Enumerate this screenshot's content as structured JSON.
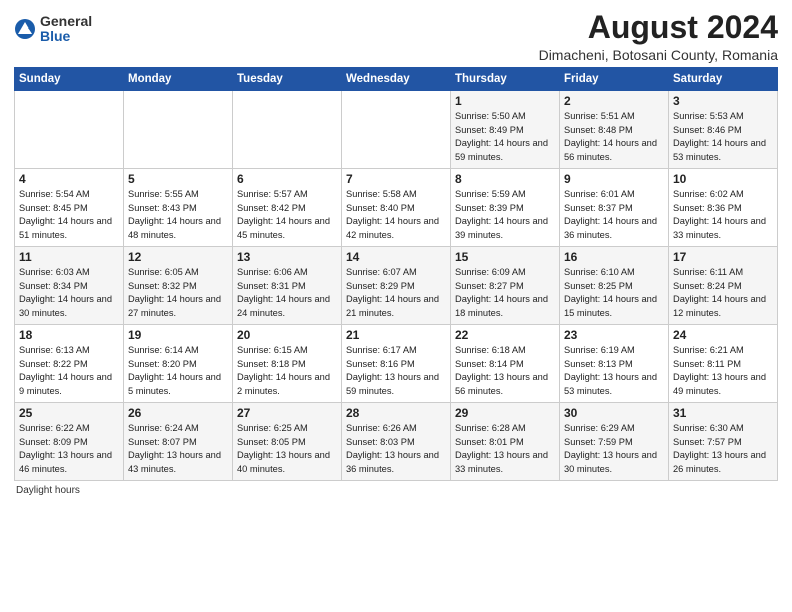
{
  "logo": {
    "general": "General",
    "blue": "Blue"
  },
  "title": "August 2024",
  "subtitle": "Dimacheni, Botosani County, Romania",
  "weekdays": [
    "Sunday",
    "Monday",
    "Tuesday",
    "Wednesday",
    "Thursday",
    "Friday",
    "Saturday"
  ],
  "weeks": [
    [
      {
        "day": "",
        "info": ""
      },
      {
        "day": "",
        "info": ""
      },
      {
        "day": "",
        "info": ""
      },
      {
        "day": "",
        "info": ""
      },
      {
        "day": "1",
        "info": "Sunrise: 5:50 AM\nSunset: 8:49 PM\nDaylight: 14 hours and 59 minutes."
      },
      {
        "day": "2",
        "info": "Sunrise: 5:51 AM\nSunset: 8:48 PM\nDaylight: 14 hours and 56 minutes."
      },
      {
        "day": "3",
        "info": "Sunrise: 5:53 AM\nSunset: 8:46 PM\nDaylight: 14 hours and 53 minutes."
      }
    ],
    [
      {
        "day": "4",
        "info": "Sunrise: 5:54 AM\nSunset: 8:45 PM\nDaylight: 14 hours and 51 minutes."
      },
      {
        "day": "5",
        "info": "Sunrise: 5:55 AM\nSunset: 8:43 PM\nDaylight: 14 hours and 48 minutes."
      },
      {
        "day": "6",
        "info": "Sunrise: 5:57 AM\nSunset: 8:42 PM\nDaylight: 14 hours and 45 minutes."
      },
      {
        "day": "7",
        "info": "Sunrise: 5:58 AM\nSunset: 8:40 PM\nDaylight: 14 hours and 42 minutes."
      },
      {
        "day": "8",
        "info": "Sunrise: 5:59 AM\nSunset: 8:39 PM\nDaylight: 14 hours and 39 minutes."
      },
      {
        "day": "9",
        "info": "Sunrise: 6:01 AM\nSunset: 8:37 PM\nDaylight: 14 hours and 36 minutes."
      },
      {
        "day": "10",
        "info": "Sunrise: 6:02 AM\nSunset: 8:36 PM\nDaylight: 14 hours and 33 minutes."
      }
    ],
    [
      {
        "day": "11",
        "info": "Sunrise: 6:03 AM\nSunset: 8:34 PM\nDaylight: 14 hours and 30 minutes."
      },
      {
        "day": "12",
        "info": "Sunrise: 6:05 AM\nSunset: 8:32 PM\nDaylight: 14 hours and 27 minutes."
      },
      {
        "day": "13",
        "info": "Sunrise: 6:06 AM\nSunset: 8:31 PM\nDaylight: 14 hours and 24 minutes."
      },
      {
        "day": "14",
        "info": "Sunrise: 6:07 AM\nSunset: 8:29 PM\nDaylight: 14 hours and 21 minutes."
      },
      {
        "day": "15",
        "info": "Sunrise: 6:09 AM\nSunset: 8:27 PM\nDaylight: 14 hours and 18 minutes."
      },
      {
        "day": "16",
        "info": "Sunrise: 6:10 AM\nSunset: 8:25 PM\nDaylight: 14 hours and 15 minutes."
      },
      {
        "day": "17",
        "info": "Sunrise: 6:11 AM\nSunset: 8:24 PM\nDaylight: 14 hours and 12 minutes."
      }
    ],
    [
      {
        "day": "18",
        "info": "Sunrise: 6:13 AM\nSunset: 8:22 PM\nDaylight: 14 hours and 9 minutes."
      },
      {
        "day": "19",
        "info": "Sunrise: 6:14 AM\nSunset: 8:20 PM\nDaylight: 14 hours and 5 minutes."
      },
      {
        "day": "20",
        "info": "Sunrise: 6:15 AM\nSunset: 8:18 PM\nDaylight: 14 hours and 2 minutes."
      },
      {
        "day": "21",
        "info": "Sunrise: 6:17 AM\nSunset: 8:16 PM\nDaylight: 13 hours and 59 minutes."
      },
      {
        "day": "22",
        "info": "Sunrise: 6:18 AM\nSunset: 8:14 PM\nDaylight: 13 hours and 56 minutes."
      },
      {
        "day": "23",
        "info": "Sunrise: 6:19 AM\nSunset: 8:13 PM\nDaylight: 13 hours and 53 minutes."
      },
      {
        "day": "24",
        "info": "Sunrise: 6:21 AM\nSunset: 8:11 PM\nDaylight: 13 hours and 49 minutes."
      }
    ],
    [
      {
        "day": "25",
        "info": "Sunrise: 6:22 AM\nSunset: 8:09 PM\nDaylight: 13 hours and 46 minutes."
      },
      {
        "day": "26",
        "info": "Sunrise: 6:24 AM\nSunset: 8:07 PM\nDaylight: 13 hours and 43 minutes."
      },
      {
        "day": "27",
        "info": "Sunrise: 6:25 AM\nSunset: 8:05 PM\nDaylight: 13 hours and 40 minutes."
      },
      {
        "day": "28",
        "info": "Sunrise: 6:26 AM\nSunset: 8:03 PM\nDaylight: 13 hours and 36 minutes."
      },
      {
        "day": "29",
        "info": "Sunrise: 6:28 AM\nSunset: 8:01 PM\nDaylight: 13 hours and 33 minutes."
      },
      {
        "day": "30",
        "info": "Sunrise: 6:29 AM\nSunset: 7:59 PM\nDaylight: 13 hours and 30 minutes."
      },
      {
        "day": "31",
        "info": "Sunrise: 6:30 AM\nSunset: 7:57 PM\nDaylight: 13 hours and 26 minutes."
      }
    ]
  ],
  "footer": "Daylight hours"
}
